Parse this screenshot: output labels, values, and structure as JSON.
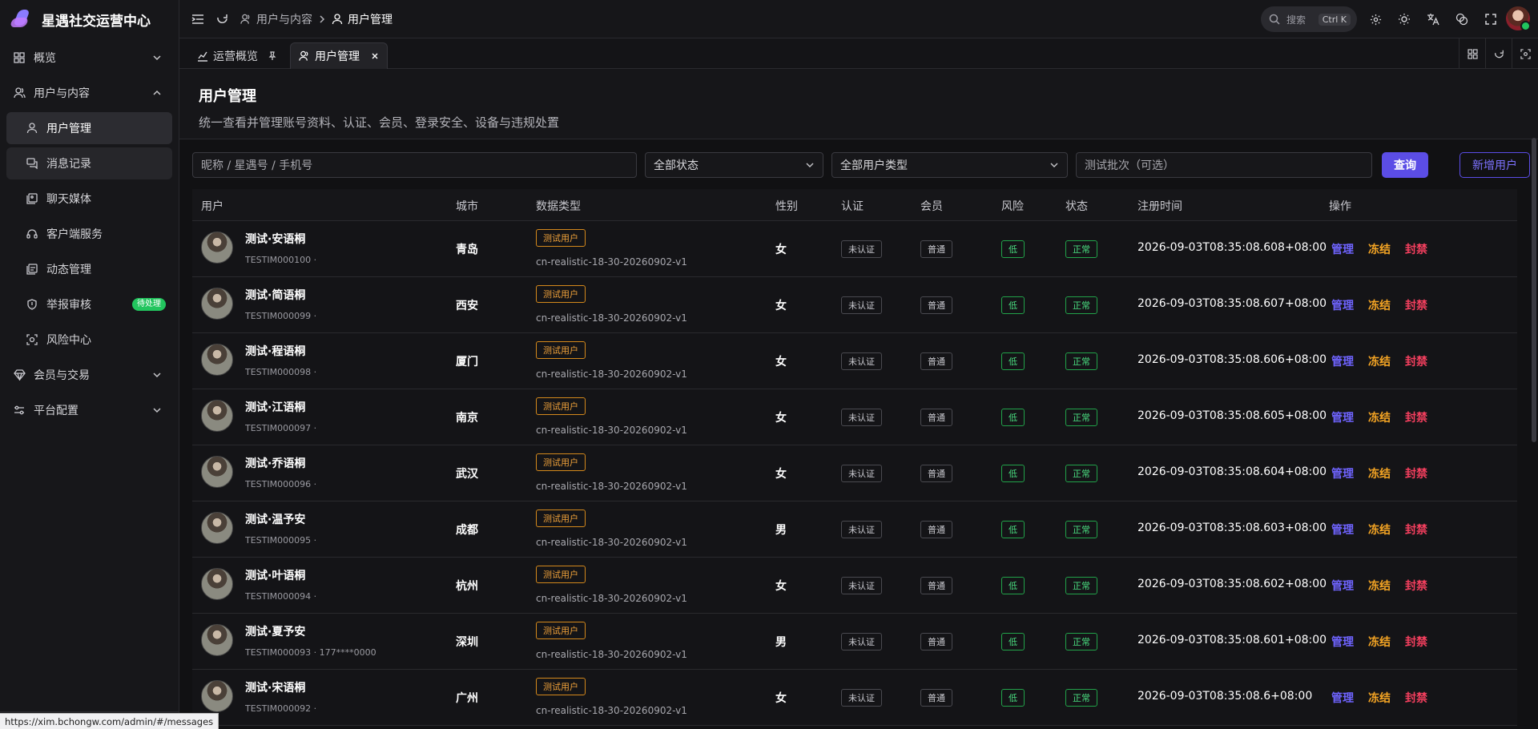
{
  "app": {
    "title": "星遇社交运营中心"
  },
  "sidebar": {
    "items": [
      {
        "label": "概览",
        "icon": "dashboard-icon"
      },
      {
        "label": "用户与内容",
        "icon": "users-icon"
      },
      {
        "label": "用户管理",
        "icon": "user-icon"
      },
      {
        "label": "消息记录",
        "icon": "message-icon"
      },
      {
        "label": "聊天媒体",
        "icon": "media-icon"
      },
      {
        "label": "客户端服务",
        "icon": "headset-icon"
      },
      {
        "label": "动态管理",
        "icon": "feed-icon"
      },
      {
        "label": "举报审核",
        "icon": "shield-icon",
        "badge": "待处理"
      },
      {
        "label": "风险中心",
        "icon": "risk-icon"
      },
      {
        "label": "会员与交易",
        "icon": "diamond-icon"
      },
      {
        "label": "平台配置",
        "icon": "settings-icon"
      }
    ]
  },
  "header": {
    "breadcrumb": [
      "用户与内容",
      "用户管理"
    ],
    "search_label": "搜索",
    "search_shortcut": "Ctrl K"
  },
  "tabs": [
    {
      "label": "运营概览"
    },
    {
      "label": "用户管理"
    }
  ],
  "page": {
    "title": "用户管理",
    "subtitle": "统一查看并管理账号资料、认证、会员、登录安全、设备与违规处置"
  },
  "filters": {
    "keyword_placeholder": "昵称 / 星遇号 / 手机号",
    "status_value": "全部状态",
    "usertype_value": "全部用户类型",
    "batch_placeholder": "测试批次（可选）",
    "query_label": "查询",
    "add_label": "新增用户"
  },
  "table": {
    "headers": [
      "用户",
      "城市",
      "数据类型",
      "性别",
      "认证",
      "会员",
      "风险",
      "状态",
      "注册时间",
      "操作"
    ],
    "actions": {
      "manage": "管理",
      "freeze": "冻结",
      "ban": "封禁"
    },
    "rows": [
      {
        "name": "测试·安语桐",
        "id": "TESTIM000100 ·",
        "city": "青岛",
        "tag": "测试用户",
        "batch": "cn-realistic-18-30-20260902-v1",
        "gender": "女",
        "cert": "未认证",
        "member": "普通",
        "risk": "低",
        "status": "正常",
        "time": "2026-09-03T08:35:08.608+08:00"
      },
      {
        "name": "测试·简语桐",
        "id": "TESTIM000099 ·",
        "city": "西安",
        "tag": "测试用户",
        "batch": "cn-realistic-18-30-20260902-v1",
        "gender": "女",
        "cert": "未认证",
        "member": "普通",
        "risk": "低",
        "status": "正常",
        "time": "2026-09-03T08:35:08.607+08:00"
      },
      {
        "name": "测试·程语桐",
        "id": "TESTIM000098 ·",
        "city": "厦门",
        "tag": "测试用户",
        "batch": "cn-realistic-18-30-20260902-v1",
        "gender": "女",
        "cert": "未认证",
        "member": "普通",
        "risk": "低",
        "status": "正常",
        "time": "2026-09-03T08:35:08.606+08:00"
      },
      {
        "name": "测试·江语桐",
        "id": "TESTIM000097 ·",
        "city": "南京",
        "tag": "测试用户",
        "batch": "cn-realistic-18-30-20260902-v1",
        "gender": "女",
        "cert": "未认证",
        "member": "普通",
        "risk": "低",
        "status": "正常",
        "time": "2026-09-03T08:35:08.605+08:00"
      },
      {
        "name": "测试·乔语桐",
        "id": "TESTIM000096 ·",
        "city": "武汉",
        "tag": "测试用户",
        "batch": "cn-realistic-18-30-20260902-v1",
        "gender": "女",
        "cert": "未认证",
        "member": "普通",
        "risk": "低",
        "status": "正常",
        "time": "2026-09-03T08:35:08.604+08:00"
      },
      {
        "name": "测试·温予安",
        "id": "TESTIM000095 ·",
        "city": "成都",
        "tag": "测试用户",
        "batch": "cn-realistic-18-30-20260902-v1",
        "gender": "男",
        "cert": "未认证",
        "member": "普通",
        "risk": "低",
        "status": "正常",
        "time": "2026-09-03T08:35:08.603+08:00"
      },
      {
        "name": "测试·叶语桐",
        "id": "TESTIM000094 ·",
        "city": "杭州",
        "tag": "测试用户",
        "batch": "cn-realistic-18-30-20260902-v1",
        "gender": "女",
        "cert": "未认证",
        "member": "普通",
        "risk": "低",
        "status": "正常",
        "time": "2026-09-03T08:35:08.602+08:00"
      },
      {
        "name": "测试·夏予安",
        "id": "TESTIM000093 · 177****0000",
        "city": "深圳",
        "tag": "测试用户",
        "batch": "cn-realistic-18-30-20260902-v1",
        "gender": "男",
        "cert": "未认证",
        "member": "普通",
        "risk": "低",
        "status": "正常",
        "time": "2026-09-03T08:35:08.601+08:00"
      },
      {
        "name": "测试·宋语桐",
        "id": "TESTIM000092 ·",
        "city": "广州",
        "tag": "测试用户",
        "batch": "cn-realistic-18-30-20260902-v1",
        "gender": "女",
        "cert": "未认证",
        "member": "普通",
        "risk": "低",
        "status": "正常",
        "time": "2026-09-03T08:35:08.6+08:00"
      }
    ]
  },
  "statusbar": {
    "url": "https://xim.bchongw.com/admin/#/messages"
  }
}
